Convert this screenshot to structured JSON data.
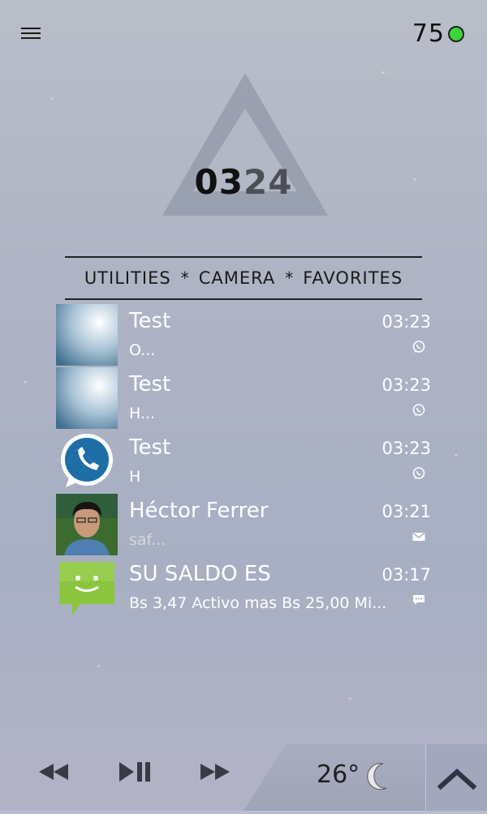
{
  "status": {
    "battery": "75"
  },
  "clock": {
    "hours": "03",
    "minutes": "24"
  },
  "shortcuts": [
    "UTILITIES",
    "CAMERA",
    "FAVORITES"
  ],
  "shortcut_separator": "*",
  "notifications": [
    {
      "title": "Test",
      "time": "03:23",
      "preview": "O...",
      "app": "whatsapp-icon",
      "avatar": "blurry-photo"
    },
    {
      "title": "Test",
      "time": "03:23",
      "preview": "H...",
      "app": "whatsapp-icon",
      "avatar": "blurry-photo"
    },
    {
      "title": "Test",
      "time": "03:23",
      "preview": "H",
      "app": "whatsapp-icon",
      "avatar": "whatsapp-logo"
    },
    {
      "title": "Héctor Ferrer",
      "time": "03:21",
      "preview": "saf...",
      "app": "mail-icon",
      "avatar": "person-photo"
    },
    {
      "title": "SU SALDO ES",
      "time": "03:17",
      "preview": "Bs 3,47 Activo mas Bs 25,00 Mi...",
      "app": "sms-icon",
      "avatar": "messaging-logo"
    }
  ],
  "weather": {
    "temperature": "26°",
    "condition_icon": "moon-icon"
  },
  "colors": {
    "battery_dot": "#3cd53a",
    "whatsapp": "#1d6fa5",
    "messaging": "#8bc53f"
  }
}
